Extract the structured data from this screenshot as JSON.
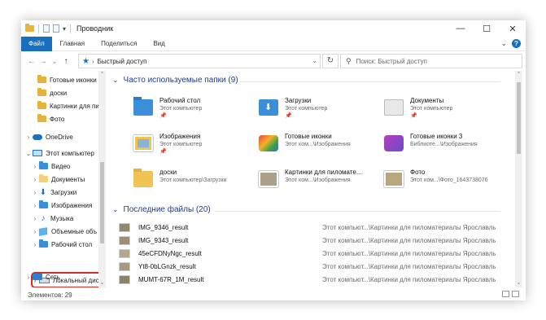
{
  "window": {
    "title": "Проводник"
  },
  "window_controls": {
    "minimize": "—",
    "maximize": "☐",
    "close": "✕"
  },
  "ribbon": {
    "tabs": [
      "Файл",
      "Главная",
      "Поделиться",
      "Вид"
    ],
    "expand": "⌄",
    "help": "?"
  },
  "address": {
    "back": "←",
    "forward": "→",
    "recent": "⌄",
    "up": "↑",
    "path_sep": "›",
    "path": "Быстрый доступ",
    "refresh": "↻",
    "search_placeholder": "Поиск: Быстрый доступ"
  },
  "nav": {
    "quick_items": [
      "Готовые иконки",
      "доски",
      "Картинки для пи",
      "Фото"
    ],
    "onedrive": "OneDrive",
    "this_pc": "Этот компьютер",
    "pc_items": [
      "Видео",
      "Документы",
      "Загрузки",
      "Изображения",
      "Музыка",
      "Объемные объ",
      "Рабочий стол"
    ],
    "local_disk": "Локальный диск (C:)",
    "network": "Сеть"
  },
  "frequent": {
    "header": "Часто используемые папки (9)",
    "folders": [
      {
        "name": "Рабочий стол",
        "location": "Этот компьютер",
        "icon": "desktop-folder-icon"
      },
      {
        "name": "Загрузки",
        "location": "Этот компьютер",
        "icon": "downloads-folder-icon"
      },
      {
        "name": "Документы",
        "location": "Этот компьютер",
        "icon": "documents-folder-icon"
      },
      {
        "name": "Изображения",
        "location": "Этот компьютер",
        "icon": "pictures-folder-icon"
      },
      {
        "name": "Готовые иконки",
        "location": "Этот ком...\\Изображения",
        "icon": "ready-icons-folder-icon"
      },
      {
        "name": "Готовые иконки 3",
        "location": "Библиоте...\\Изображения",
        "icon": "ready-icons-3-folder-icon"
      },
      {
        "name": "доски",
        "location": "Этот компьютер\\Загрузки",
        "icon": "boards-folder-icon"
      },
      {
        "name": "Картинки для пиломате...",
        "location": "Этот ком...\\Изображения",
        "icon": "pictures-lumber-folder-icon"
      },
      {
        "name": "Фото",
        "location": "Этот ком...\\Фото_1643738076",
        "icon": "photo-folder-icon"
      }
    ]
  },
  "recent": {
    "header": "Последние файлы (20)",
    "files": [
      {
        "name": "IMG_9346_result",
        "path": "Этот компьют...\\Картинки для пиломатериалы Ярославль"
      },
      {
        "name": "IMG_9343_result",
        "path": "Этот компьют...\\Картинки для пиломатериалы Ярославль"
      },
      {
        "name": "45eCFDNyNgc_result",
        "path": "Этот компьют...\\Картинки для пиломатериалы Ярославль"
      },
      {
        "name": "Yt8-0bLGnzk_result",
        "path": "Этот компьют...\\Картинки для пиломатериалы Ярославль"
      },
      {
        "name": "MUMT-67R_1M_result",
        "path": "Этот компьют...\\Картинки для пиломатериалы Ярославль"
      }
    ]
  },
  "status": {
    "elements": "Элементов: 29"
  },
  "colors": {
    "accent": "#1a6fbd",
    "highlight": "#d32d27",
    "folder": "#f0c355",
    "section": "#1e3d8f"
  }
}
